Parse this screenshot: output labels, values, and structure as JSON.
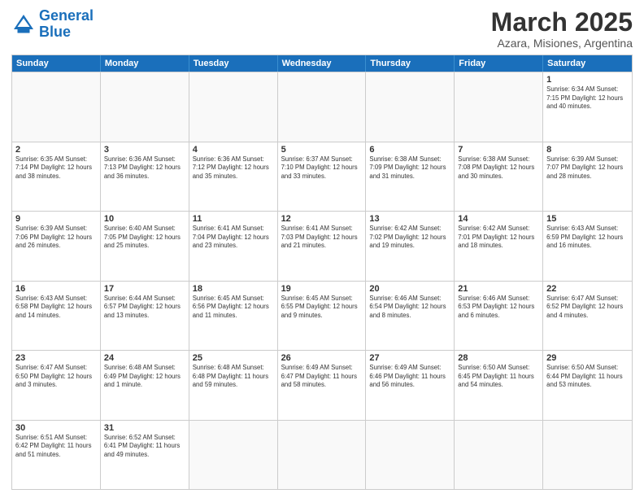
{
  "header": {
    "logo_general": "General",
    "logo_blue": "Blue",
    "month": "March 2025",
    "location": "Azara, Misiones, Argentina"
  },
  "days": [
    "Sunday",
    "Monday",
    "Tuesday",
    "Wednesday",
    "Thursday",
    "Friday",
    "Saturday"
  ],
  "rows": [
    [
      {
        "day": "",
        "info": ""
      },
      {
        "day": "",
        "info": ""
      },
      {
        "day": "",
        "info": ""
      },
      {
        "day": "",
        "info": ""
      },
      {
        "day": "",
        "info": ""
      },
      {
        "day": "",
        "info": ""
      },
      {
        "day": "1",
        "info": "Sunrise: 6:34 AM\nSunset: 7:15 PM\nDaylight: 12 hours\nand 40 minutes."
      }
    ],
    [
      {
        "day": "2",
        "info": "Sunrise: 6:35 AM\nSunset: 7:14 PM\nDaylight: 12 hours\nand 38 minutes."
      },
      {
        "day": "3",
        "info": "Sunrise: 6:36 AM\nSunset: 7:13 PM\nDaylight: 12 hours\nand 36 minutes."
      },
      {
        "day": "4",
        "info": "Sunrise: 6:36 AM\nSunset: 7:12 PM\nDaylight: 12 hours\nand 35 minutes."
      },
      {
        "day": "5",
        "info": "Sunrise: 6:37 AM\nSunset: 7:10 PM\nDaylight: 12 hours\nand 33 minutes."
      },
      {
        "day": "6",
        "info": "Sunrise: 6:38 AM\nSunset: 7:09 PM\nDaylight: 12 hours\nand 31 minutes."
      },
      {
        "day": "7",
        "info": "Sunrise: 6:38 AM\nSunset: 7:08 PM\nDaylight: 12 hours\nand 30 minutes."
      },
      {
        "day": "8",
        "info": "Sunrise: 6:39 AM\nSunset: 7:07 PM\nDaylight: 12 hours\nand 28 minutes."
      }
    ],
    [
      {
        "day": "9",
        "info": "Sunrise: 6:39 AM\nSunset: 7:06 PM\nDaylight: 12 hours\nand 26 minutes."
      },
      {
        "day": "10",
        "info": "Sunrise: 6:40 AM\nSunset: 7:05 PM\nDaylight: 12 hours\nand 25 minutes."
      },
      {
        "day": "11",
        "info": "Sunrise: 6:41 AM\nSunset: 7:04 PM\nDaylight: 12 hours\nand 23 minutes."
      },
      {
        "day": "12",
        "info": "Sunrise: 6:41 AM\nSunset: 7:03 PM\nDaylight: 12 hours\nand 21 minutes."
      },
      {
        "day": "13",
        "info": "Sunrise: 6:42 AM\nSunset: 7:02 PM\nDaylight: 12 hours\nand 19 minutes."
      },
      {
        "day": "14",
        "info": "Sunrise: 6:42 AM\nSunset: 7:01 PM\nDaylight: 12 hours\nand 18 minutes."
      },
      {
        "day": "15",
        "info": "Sunrise: 6:43 AM\nSunset: 6:59 PM\nDaylight: 12 hours\nand 16 minutes."
      }
    ],
    [
      {
        "day": "16",
        "info": "Sunrise: 6:43 AM\nSunset: 6:58 PM\nDaylight: 12 hours\nand 14 minutes."
      },
      {
        "day": "17",
        "info": "Sunrise: 6:44 AM\nSunset: 6:57 PM\nDaylight: 12 hours\nand 13 minutes."
      },
      {
        "day": "18",
        "info": "Sunrise: 6:45 AM\nSunset: 6:56 PM\nDaylight: 12 hours\nand 11 minutes."
      },
      {
        "day": "19",
        "info": "Sunrise: 6:45 AM\nSunset: 6:55 PM\nDaylight: 12 hours\nand 9 minutes."
      },
      {
        "day": "20",
        "info": "Sunrise: 6:46 AM\nSunset: 6:54 PM\nDaylight: 12 hours\nand 8 minutes."
      },
      {
        "day": "21",
        "info": "Sunrise: 6:46 AM\nSunset: 6:53 PM\nDaylight: 12 hours\nand 6 minutes."
      },
      {
        "day": "22",
        "info": "Sunrise: 6:47 AM\nSunset: 6:52 PM\nDaylight: 12 hours\nand 4 minutes."
      }
    ],
    [
      {
        "day": "23",
        "info": "Sunrise: 6:47 AM\nSunset: 6:50 PM\nDaylight: 12 hours\nand 3 minutes."
      },
      {
        "day": "24",
        "info": "Sunrise: 6:48 AM\nSunset: 6:49 PM\nDaylight: 12 hours\nand 1 minute."
      },
      {
        "day": "25",
        "info": "Sunrise: 6:48 AM\nSunset: 6:48 PM\nDaylight: 11 hours\nand 59 minutes."
      },
      {
        "day": "26",
        "info": "Sunrise: 6:49 AM\nSunset: 6:47 PM\nDaylight: 11 hours\nand 58 minutes."
      },
      {
        "day": "27",
        "info": "Sunrise: 6:49 AM\nSunset: 6:46 PM\nDaylight: 11 hours\nand 56 minutes."
      },
      {
        "day": "28",
        "info": "Sunrise: 6:50 AM\nSunset: 6:45 PM\nDaylight: 11 hours\nand 54 minutes."
      },
      {
        "day": "29",
        "info": "Sunrise: 6:50 AM\nSunset: 6:44 PM\nDaylight: 11 hours\nand 53 minutes."
      }
    ],
    [
      {
        "day": "30",
        "info": "Sunrise: 6:51 AM\nSunset: 6:42 PM\nDaylight: 11 hours\nand 51 minutes."
      },
      {
        "day": "31",
        "info": "Sunrise: 6:52 AM\nSunset: 6:41 PM\nDaylight: 11 hours\nand 49 minutes."
      },
      {
        "day": "",
        "info": ""
      },
      {
        "day": "",
        "info": ""
      },
      {
        "day": "",
        "info": ""
      },
      {
        "day": "",
        "info": ""
      },
      {
        "day": "",
        "info": ""
      }
    ]
  ]
}
